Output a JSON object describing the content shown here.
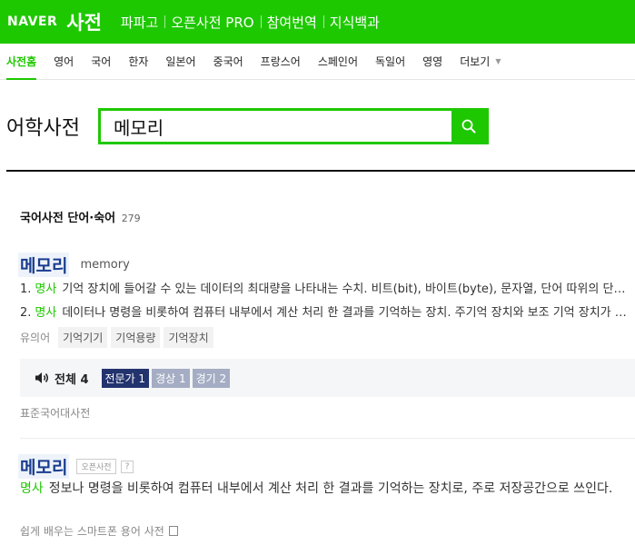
{
  "header": {
    "logo": "NAVER",
    "brand": "사전",
    "nav": [
      "파파고",
      "오픈사전 PRO",
      "참여번역",
      "지식백과"
    ]
  },
  "tabs": [
    "사전홈",
    "영어",
    "국어",
    "한자",
    "일본어",
    "중국어",
    "프랑스어",
    "스페인어",
    "독일어",
    "영영",
    "더보기"
  ],
  "search": {
    "title": "어학사전",
    "query": "메모리"
  },
  "results": {
    "section_title": "국어사전 단어·숙어",
    "section_count": "279",
    "entry1": {
      "word": "메모리",
      "origin": "memory",
      "defs": [
        {
          "num": "1.",
          "pos": "명사",
          "text": "기억 장치에 들어갈 수 있는 데이터의 최대량을 나타내는 수치. 비트(bit), 바이트(byte), 문자열, 단어 따위의 단위로 나타낸다."
        },
        {
          "num": "2.",
          "pos": "명사",
          "text": "데이터나 명령을 비롯하여 컴퓨터 내부에서 계산 처리 한 결과를 기억하는 장치. 주기억 장치와 보조 기억 장치가 있다."
        }
      ],
      "syn_label": "유의어",
      "synonyms": [
        "기억기기",
        "기억용량",
        "기억장치"
      ],
      "audio_all": "전체 4",
      "badges": [
        {
          "label": "전문가 1",
          "style": "dark"
        },
        {
          "label": "경상 1",
          "style": "light"
        },
        {
          "label": "경기 2",
          "style": "light"
        }
      ],
      "source": "표준국어대사전"
    },
    "entry2": {
      "word": "메모리",
      "tag": "오픈사전",
      "q": "?",
      "pos": "명사",
      "text": "정보나 명령을 비롯하여 컴퓨터 내부에서 계산 처리 한 결과를 기억하는 장치로, 주로 저장공간으로 쓰인다.",
      "source": "쉽게 배우는 스마트폰 용어 사전"
    }
  },
  "colors": {
    "accent": "#1ec800",
    "entry_word": "#1a3d8f",
    "badge_dark": "#23336e",
    "badge_light": "#a4adc3"
  }
}
